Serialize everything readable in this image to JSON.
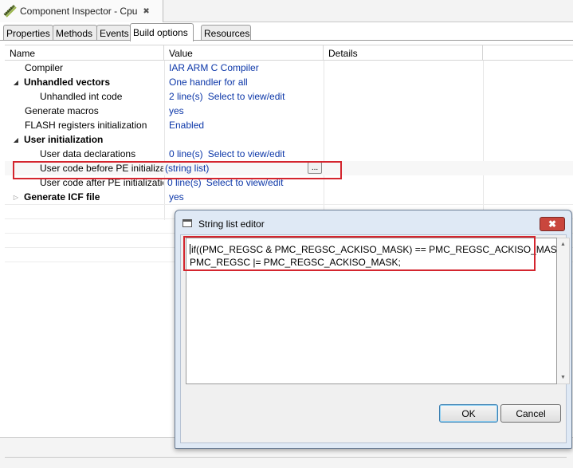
{
  "view": {
    "title": "Component Inspector - Cpu",
    "icon": "component-inspector-icon",
    "close_label": "✖"
  },
  "tabs": [
    {
      "label": "Properties"
    },
    {
      "label": "Methods"
    },
    {
      "label": "Events"
    },
    {
      "label": "Build options",
      "active": true
    },
    {
      "label": "Resources"
    }
  ],
  "table": {
    "headers": {
      "name": "Name",
      "value": "Value",
      "details": "Details"
    },
    "rows": [
      {
        "name": "Compiler",
        "value": "IAR ARM C Compiler"
      },
      {
        "name": "Unhandled vectors",
        "value": "One handler for all",
        "group": true,
        "expanded": true
      },
      {
        "name": "Unhandled int code",
        "value": "2 line(s)",
        "link": "Select to view/edit"
      },
      {
        "name": "Generate macros",
        "value": "yes"
      },
      {
        "name": "FLASH registers initialization",
        "value": "Enabled"
      },
      {
        "name": "User initialization",
        "value": "",
        "group": true,
        "expanded": true
      },
      {
        "name": "User data declarations",
        "value": "0 line(s)",
        "link": "Select to view/edit"
      },
      {
        "name": "User code before PE initialization",
        "value": "(string list)",
        "button": "..."
      },
      {
        "name": "User code after PE initialization",
        "value": "0 line(s)",
        "link": "Select to view/edit"
      },
      {
        "name": "Generate ICF file",
        "value": "yes",
        "group": true,
        "expanded": false
      }
    ]
  },
  "dialog": {
    "title": "String list editor",
    "close_label": "✖",
    "text_lines": [
      "if((PMC_REGSC & PMC_REGSC_ACKISO_MASK) == PMC_REGSC_ACKISO_MASK)",
      "PMC_REGSC |= PMC_REGSC_ACKISO_MASK;"
    ],
    "ok_label": "OK",
    "cancel_label": "Cancel"
  },
  "colors": {
    "value_text": "#0b36a8",
    "highlight_box": "#d4252e",
    "dialog_frame": "#dfe9f5"
  }
}
